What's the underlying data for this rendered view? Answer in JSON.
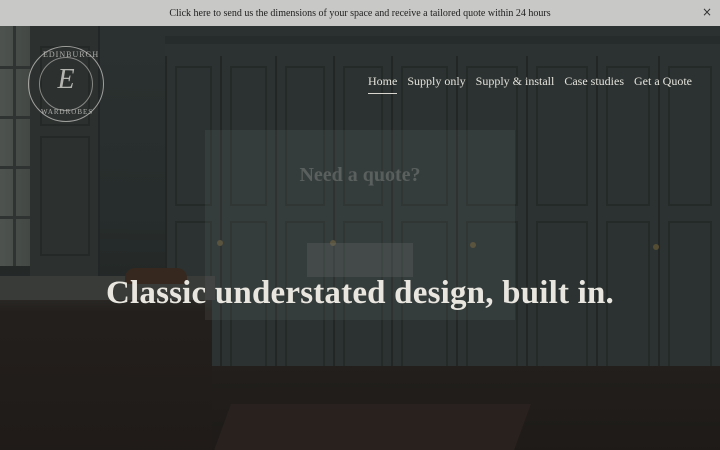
{
  "announcement": {
    "text": "Click here to send us the dimensions of your space and receive a tailored quote within 24 hours",
    "close_label": "×"
  },
  "logo": {
    "monogram": "E",
    "arc_top": "EDINBURGH",
    "arc_bottom": "WARDROBES"
  },
  "nav": {
    "items": [
      {
        "label": "Home",
        "active": true
      },
      {
        "label": "Supply only"
      },
      {
        "label": "Supply & install"
      },
      {
        "label": "Case studies"
      },
      {
        "label": "Get a Quote"
      }
    ]
  },
  "quote_popup": {
    "title": "Need a quote?"
  },
  "hero": {
    "headline": "Classic understated design, built in."
  },
  "colors": {
    "announcement_bg": "#c8c8c6",
    "nav_text": "#e5e3dc",
    "headline_text": "#e8e6df"
  }
}
